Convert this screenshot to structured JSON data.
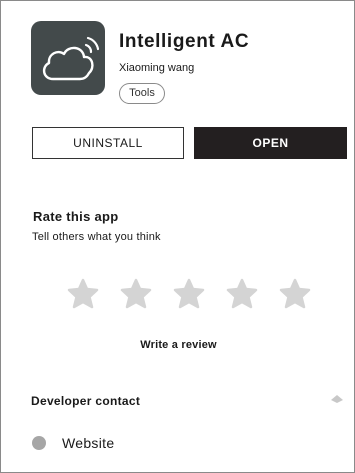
{
  "app": {
    "name": "Intelligent AC",
    "developer": "Xiaoming wang",
    "tag": "Tools",
    "icon": "cloud-wifi-icon",
    "icon_bg": "#434a4b"
  },
  "actions": {
    "uninstall_label": "UNINSTALL",
    "open_label": "OPEN",
    "open_bg": "#231f20"
  },
  "rating": {
    "title": "Rate this app",
    "subtitle": "Tell others what you think",
    "star_icon": "star-icon",
    "star_count": 5,
    "star_color": "#d4d4d4",
    "write_review_label": "Write a review"
  },
  "developer_contact": {
    "title": "Developer contact",
    "expand_icon": "chevron-up-icon",
    "items": [
      {
        "label": "Website",
        "icon": "globe-dot-icon"
      }
    ]
  }
}
